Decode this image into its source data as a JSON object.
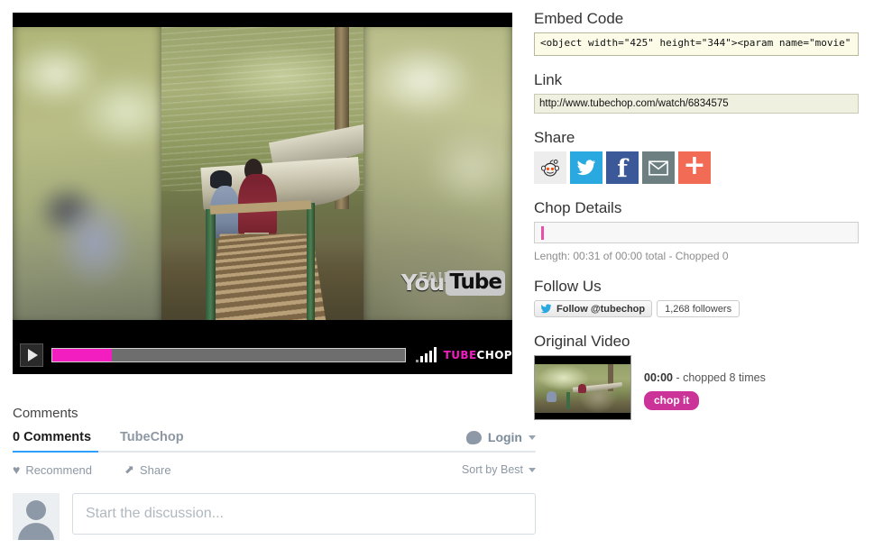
{
  "player": {
    "watermark": "FAIL ARMY",
    "youtube_you": "You",
    "youtube_tube": "Tube",
    "logo_a": "TUBE",
    "logo_b": "CHOP",
    "progress_percent": 17
  },
  "sidebar": {
    "embed": {
      "heading": "Embed Code",
      "value": "<object width=\"425\" height=\"344\"><param name=\"movie\""
    },
    "link": {
      "heading": "Link",
      "value": "http://www.tubechop.com/watch/6834575"
    },
    "share": {
      "heading": "Share",
      "buttons": [
        {
          "name": "reddit",
          "label": "reddit",
          "color": "#ededed"
        },
        {
          "name": "twitter",
          "label": "twitter",
          "color": "#29a9e0"
        },
        {
          "name": "facebook",
          "label": "facebook",
          "color": "#3b5998",
          "glyph": "f"
        },
        {
          "name": "email",
          "label": "email",
          "color": "#6d7f80"
        },
        {
          "name": "addthis",
          "label": "more",
          "color": "#f26b54",
          "glyph": "+"
        }
      ]
    },
    "chop_details": {
      "heading": "Chop Details",
      "value": "",
      "length_text": "Length: 00:31 of 00:00 total - Chopped 0"
    },
    "follow": {
      "heading": "Follow Us",
      "button_label": "Follow @tubechop",
      "followers_label": "1,268 followers"
    },
    "original": {
      "heading": "Original Video",
      "time": "00:00",
      "chopped_text": "- chopped 8 times",
      "chop_button": "chop it"
    }
  },
  "comments": {
    "title": "Comments",
    "tabs": [
      {
        "label": "0 Comments",
        "active": true
      },
      {
        "label": "TubeChop",
        "active": false
      }
    ],
    "login_label": "Login",
    "actions": [
      {
        "icon": "heart-icon",
        "label": "Recommend"
      },
      {
        "icon": "share-icon",
        "label": "Share"
      }
    ],
    "sort_label": "Sort by Best",
    "editor_placeholder": "Start the discussion..."
  },
  "colors": {
    "accent_magenta": "#cc3399",
    "progress_magenta": "#f21ec0",
    "disqus_blue": "#2e9fff",
    "twitter_blue": "#29a9e0",
    "facebook_blue": "#3b5998"
  }
}
